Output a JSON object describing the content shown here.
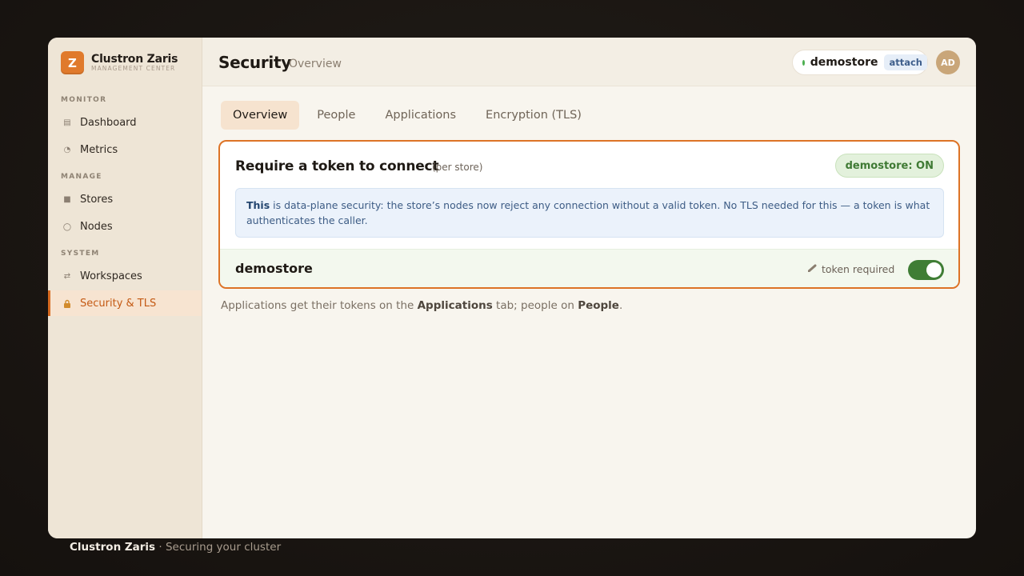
{
  "brand": {
    "name": "Clustron Zaris",
    "subtitle": "MANAGEMENT CENTER",
    "logo_letter": "Z",
    "accent": "#e07a2c"
  },
  "sidebar": {
    "sections": [
      {
        "label": "MONITOR"
      },
      {
        "label": "MANAGE"
      },
      {
        "label": "SYSTEM"
      }
    ],
    "items": [
      {
        "label": "Dashboard",
        "icon": "dashboard-icon"
      },
      {
        "label": "Metrics",
        "icon": "metrics-icon"
      },
      {
        "label": "Stores",
        "icon": "stores-icon"
      },
      {
        "label": "Nodes",
        "icon": "nodes-icon"
      },
      {
        "label": "Workspaces",
        "icon": "swap-icon"
      },
      {
        "label": "Security & TLS",
        "icon": "lock-icon",
        "active": true
      }
    ]
  },
  "header": {
    "title": "Security",
    "subtitle": "Overview",
    "store_name": "demostore",
    "store_status_color": "#4caf50",
    "attach_label": "attach",
    "avatar_initials": "AD"
  },
  "tabs": [
    {
      "label": "Overview",
      "active": true
    },
    {
      "label": "People"
    },
    {
      "label": "Applications"
    },
    {
      "label": "Encryption (TLS)"
    }
  ],
  "card": {
    "title": "Require a token to connect",
    "title_note": "(per store)",
    "badge": "demostore: ON",
    "info_lead": "This",
    "info_text": " is data-plane security: the store’s nodes now reject any connection without a valid token. No TLS needed for this — a token is what authenticates the caller.",
    "store_row": {
      "name": "demostore",
      "token_label": "token required",
      "toggle_on": true
    }
  },
  "helper": {
    "part1": "Applications get their tokens on the ",
    "link1": "Applications",
    "part2": " tab; people on ",
    "link2": "People",
    "part3": "."
  },
  "footer": {
    "brand": "Clustron Zaris",
    "caption": " · Securing your cluster"
  }
}
